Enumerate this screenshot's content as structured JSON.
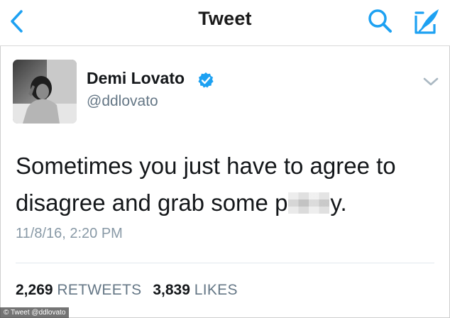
{
  "nav": {
    "title": "Tweet",
    "back_icon": "chevron-left-icon",
    "search_icon": "search-icon",
    "compose_icon": "compose-feather-icon",
    "accent_color": "#1da1f2"
  },
  "tweet": {
    "display_name": "Demi Lovato",
    "verified": true,
    "handle": "@ddlovato",
    "text_part1": "Sometimes you just have to agree to disagree and grab some p",
    "text_part2": "y.",
    "timestamp": "11/8/16, 2:20 PM",
    "retweets_count": "2,269",
    "retweets_label": "RETWEETS",
    "likes_count": "3,839",
    "likes_label": "LIKES"
  },
  "caption": "© Tweet @ddlovato"
}
